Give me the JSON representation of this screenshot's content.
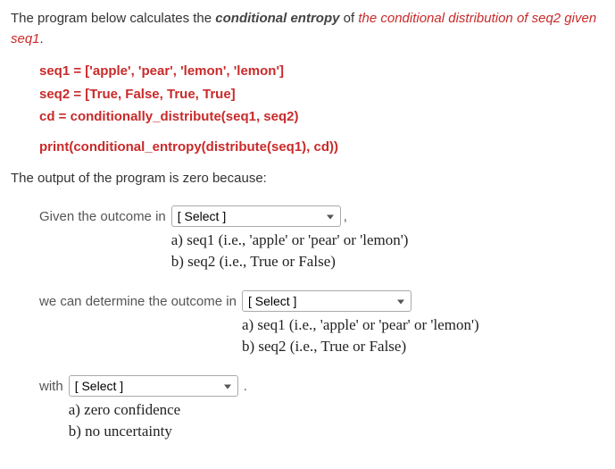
{
  "intro": {
    "part1": "The program below calculates the ",
    "emph": "conditional entropy",
    "part2": " of ",
    "highlight": "the conditional distribution of seq2 given seq1",
    "part3": "."
  },
  "code": {
    "line1": "seq1 = ['apple', 'pear', 'lemon', 'lemon']",
    "line2": "seq2 = [True, False, True, True]",
    "line3": "cd = conditionally_distribute(seq1, seq2)",
    "line4": "print(conditional_entropy(distribute(seq1), cd))"
  },
  "question": "The output of the program is zero because:",
  "row1": {
    "label": "Given the outcome in",
    "select_placeholder": "[ Select ]",
    "opt_a": "a) seq1 (i.e., 'apple' or 'pear' or 'lemon')",
    "opt_b": "b) seq2 (i.e., True or False)",
    "trail": ","
  },
  "row2": {
    "label": "we can determine the outcome in",
    "select_placeholder": "[ Select ]",
    "opt_a": "a) seq1 (i.e., 'apple' or 'pear' or 'lemon')",
    "opt_b": "b) seq2 (i.e., True or False)"
  },
  "row3": {
    "label": "with",
    "select_placeholder": "[ Select ]",
    "opt_a": "a) zero confidence",
    "opt_b": "b) no uncertainty",
    "trail": "."
  }
}
